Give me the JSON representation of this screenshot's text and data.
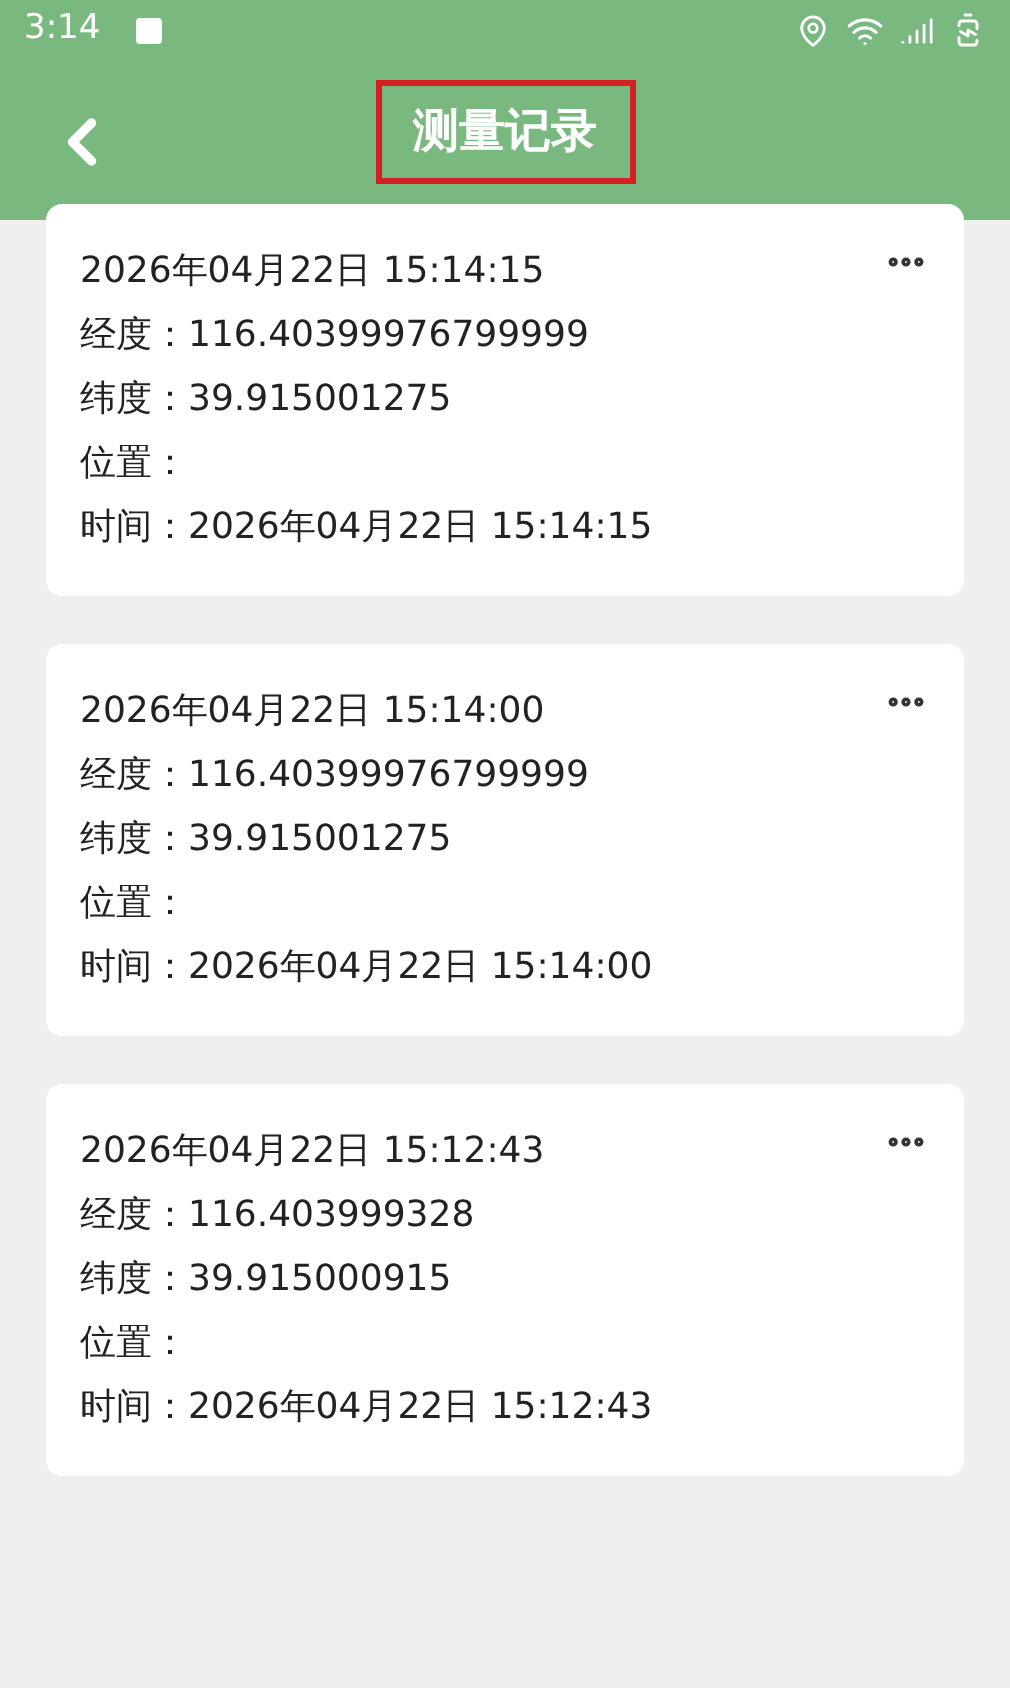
{
  "status_bar": {
    "time": "3:14"
  },
  "header": {
    "title": "测量记录"
  },
  "records": [
    {
      "heading": "2026年04月22日 15:14:15",
      "lines": [
        {
          "label": "经度：",
          "value": "116.40399976799999"
        },
        {
          "label": "纬度：",
          "value": "39.915001275"
        },
        {
          "label": "位置："
        },
        {
          "label": "时间：",
          "value": "2026年04月22日 15:14:15"
        }
      ]
    },
    {
      "heading": "2026年04月22日 15:14:00",
      "lines": [
        {
          "label": "经度：",
          "value": "116.40399976799999"
        },
        {
          "label": "纬度：",
          "value": "39.915001275"
        },
        {
          "label": "位置："
        },
        {
          "label": "时间：",
          "value": "2026年04月22日 15:14:00"
        }
      ]
    },
    {
      "heading": "2026年04月22日 15:12:43",
      "lines": [
        {
          "label": "经度：",
          "value": "116.403999328"
        },
        {
          "label": "纬度：",
          "value": "39.915000915"
        },
        {
          "label": "位置："
        },
        {
          "label": "时间：",
          "value": "2026年04月22日 15:12:43"
        }
      ]
    }
  ]
}
